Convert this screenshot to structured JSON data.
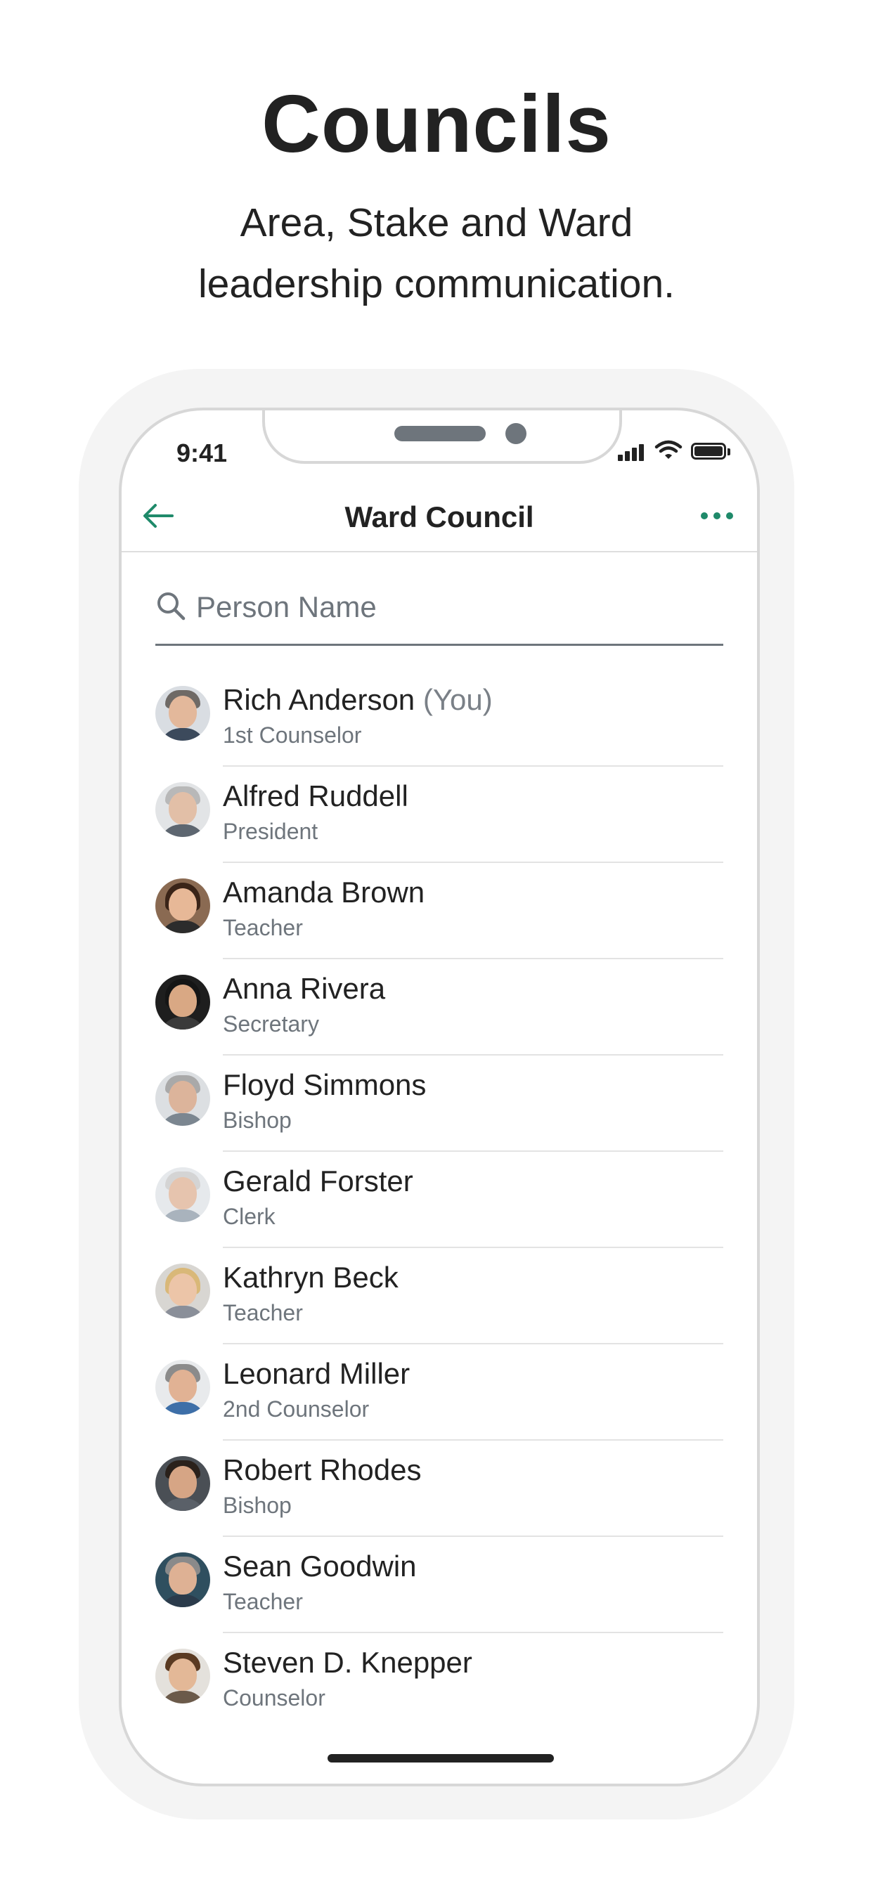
{
  "hero": {
    "title": "Councils",
    "subtitle_line1": "Area, Stake and Ward",
    "subtitle_line2": "leadership communication."
  },
  "status_bar": {
    "time": "9:41",
    "icons": [
      "cellular-signal-icon",
      "wifi-icon",
      "battery-icon"
    ]
  },
  "nav": {
    "title": "Ward Council",
    "back_icon": "arrow-left-icon",
    "more_icon": "more-horizontal-icon"
  },
  "search": {
    "placeholder": "Person Name",
    "value": ""
  },
  "colors": {
    "accent": "#1f8a6a",
    "text_primary": "#222222",
    "text_secondary": "#6e757c",
    "divider": "#e3e3e3",
    "phone_frame": "#f4f4f4"
  },
  "people": [
    {
      "name": "Rich Anderson",
      "tag": "(You)",
      "role": "1st Counselor"
    },
    {
      "name": "Alfred Ruddell",
      "role": "President"
    },
    {
      "name": "Amanda Brown",
      "role": "Teacher"
    },
    {
      "name": "Anna Rivera",
      "role": "Secretary"
    },
    {
      "name": "Floyd Simmons",
      "role": "Bishop"
    },
    {
      "name": "Gerald Forster",
      "role": "Clerk"
    },
    {
      "name": "Kathryn Beck",
      "role": "Teacher"
    },
    {
      "name": "Leonard Miller",
      "role": "2nd Counselor"
    },
    {
      "name": "Robert Rhodes",
      "role": "Bishop"
    },
    {
      "name": "Sean Goodwin",
      "role": "Teacher"
    },
    {
      "name": "Steven D. Knepper",
      "role": "Counselor"
    }
  ]
}
